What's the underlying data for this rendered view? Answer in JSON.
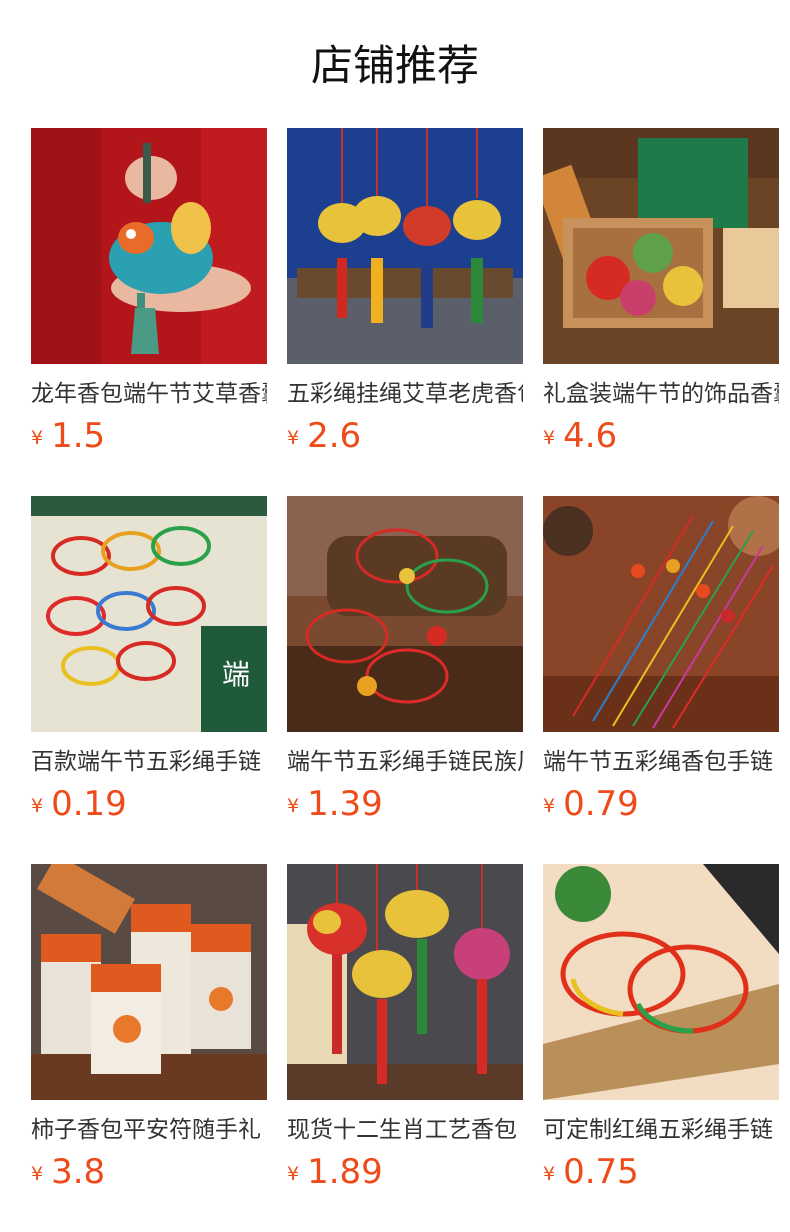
{
  "page": {
    "title": "店铺推荐"
  },
  "currency_symbol": "¥",
  "products": [
    {
      "name": "龙年香包端午节艾草香囊",
      "price": "1.5",
      "image": "dragon-sachet-photo"
    },
    {
      "name": "五彩绳挂绳艾草老虎香包",
      "price": "2.6",
      "image": "tiger-pendants-photo"
    },
    {
      "name": "礼盒装端午节的饰品香囊",
      "price": "4.6",
      "image": "gift-box-sachets-photo"
    },
    {
      "name": "百款端午节五彩绳手链",
      "price": "0.19",
      "image": "bracelets-collection-photo"
    },
    {
      "name": "端午节五彩绳手链民族风",
      "price": "1.39",
      "image": "charm-bracelets-photo"
    },
    {
      "name": "端午节五彩绳香包手链",
      "price": "0.79",
      "image": "colored-strings-photo"
    },
    {
      "name": "柿子香包平安符随手礼",
      "price": "3.8",
      "image": "persimmon-sachet-packs-photo"
    },
    {
      "name": "现货十二生肖工艺香包",
      "price": "1.89",
      "image": "zodiac-sachets-photo"
    },
    {
      "name": "可定制红绳五彩绳手链",
      "price": "0.75",
      "image": "red-string-bracelets-photo"
    }
  ],
  "colors": {
    "price": "#ee4b1a",
    "text": "#333333"
  }
}
